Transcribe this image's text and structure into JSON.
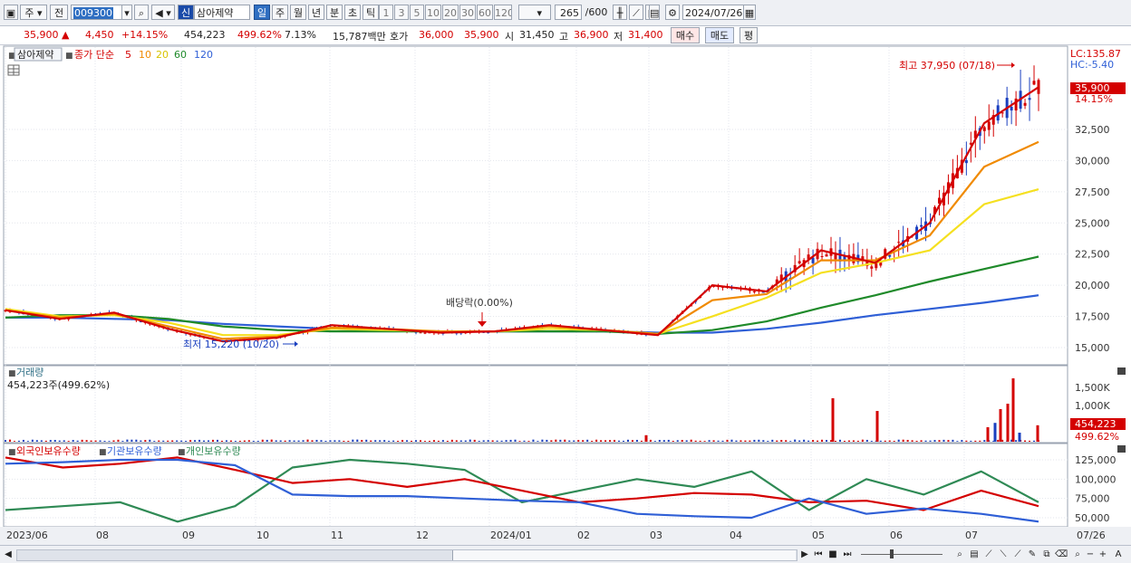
{
  "toolbar": {
    "stock_code": "009300",
    "mode_label": "주",
    "prev_label": "전",
    "sin_label": "신",
    "stock_name": "삼아제약",
    "periods": [
      "일",
      "주",
      "월",
      "년",
      "분",
      "초",
      "틱"
    ],
    "intervals": [
      "1",
      "3",
      "5",
      "10",
      "20",
      "30",
      "60",
      "120"
    ],
    "count": "265",
    "count_total": "/600",
    "date": "2024/07/26"
  },
  "quote": {
    "price": "35,900",
    "change": "4,450",
    "change_pct": "+14.15%",
    "volume": "454,223",
    "vol_ratio": "499.62%",
    "turnover": "7.13%",
    "amount": "15,787백만",
    "hoga_label": "호가",
    "ask": "36,000",
    "bid": "35,900",
    "open_label": "시",
    "open": "31,450",
    "high_label": "고",
    "high": "36,900",
    "low_label": "저",
    "low": "31,400",
    "buy_label": "매수",
    "sell_label": "매도",
    "eval_label": "평"
  },
  "colors": {
    "up": "#d40000",
    "down": "#1a3fbf",
    "ma5": "#d40000",
    "ma10": "#f08a00",
    "ma20": "#f5e020",
    "ma60": "#1f8a2a",
    "ma120": "#2f5fd6",
    "foreign": "#d40000",
    "institution": "#2f5fd6",
    "individual": "#2f8a55"
  },
  "price_panel": {
    "stock_name": "삼아제약",
    "legend_prefix": "종가 단순",
    "ma_periods": [
      "5",
      "10",
      "20",
      "60",
      "120"
    ],
    "lc": "LC:135.87",
    "hc": "HC:-5.40",
    "current_price": "35,900",
    "current_pct": "14.15%",
    "high_annotation": "최고 37,950 (07/18)",
    "low_annotation": "최저 15,220 (10/20)",
    "dividend_annotation": "배당락(0.00%)",
    "y_ticks": [
      "32,500",
      "30,000",
      "27,500",
      "25,000",
      "22,500",
      "20,000",
      "17,500",
      "15,000"
    ]
  },
  "volume_panel": {
    "title": "거래량",
    "summary": "454,223주(499.62%)",
    "y_ticks": [
      "1,500K",
      "1,000K"
    ],
    "current": "454,223",
    "current_pct": "499.62%"
  },
  "holding_panel": {
    "legend": [
      "외국인보유수량",
      "기관보유수량",
      "개인보유수량"
    ],
    "y_ticks": [
      "125,000",
      "100,000",
      "75,000",
      "50,000"
    ]
  },
  "x_axis": {
    "labels": [
      "2023/06",
      "08",
      "09",
      "10",
      "11",
      "12",
      "2024/01",
      "02",
      "03",
      "04",
      "05",
      "06",
      "07"
    ],
    "end_label": "07/26"
  },
  "chart_data": [
    {
      "type": "line",
      "title": "삼아제약",
      "x_range": [
        "2023/06",
        "2024/07/26"
      ],
      "ylim": [
        14000,
        37950
      ],
      "series": [
        {
          "name": "종가 단순 5",
          "approx_values": [
            18000,
            17300,
            17800,
            16500,
            15500,
            15800,
            16800,
            16500,
            16200,
            16300,
            16800,
            16400,
            16000,
            20000,
            19500,
            22800,
            21800,
            25000,
            33000,
            35900
          ]
        },
        {
          "name": "10",
          "approx_values": [
            18000,
            17400,
            17700,
            16700,
            15700,
            15900,
            16600,
            16500,
            16300,
            16300,
            16700,
            16400,
            16100,
            18800,
            19300,
            22000,
            22000,
            24000,
            29500,
            31500
          ]
        },
        {
          "name": "20",
          "approx_values": [
            18100,
            17500,
            17600,
            17000,
            16000,
            16000,
            16500,
            16400,
            16300,
            16300,
            16500,
            16400,
            16100,
            17500,
            19000,
            21000,
            21800,
            22800,
            26500,
            27700
          ]
        },
        {
          "name": "60",
          "approx_values": [
            17400,
            17600,
            17600,
            17300,
            16700,
            16400,
            16300,
            16300,
            16300,
            16300,
            16300,
            16300,
            16100,
            16400,
            17100,
            18200,
            19200,
            20300,
            21300,
            22300
          ]
        },
        {
          "name": "120",
          "approx_values": [
            17400,
            17400,
            17300,
            17200,
            16900,
            16700,
            16500,
            16400,
            16300,
            16300,
            16300,
            16300,
            16200,
            16200,
            16500,
            17000,
            17600,
            18100,
            18600,
            19200
          ]
        }
      ],
      "annotations": {
        "high": 37950,
        "high_date": "07/18",
        "low": 15220,
        "low_date": "10/20",
        "last": 35900
      }
    },
    {
      "type": "bar",
      "title": "거래량",
      "note": "volume spikes near 05, 06 and late 07",
      "spikes": [
        {
          "date": "05",
          "value": 1200000
        },
        {
          "date": "06",
          "value": 850000
        },
        {
          "date": "07 late",
          "value": 1750000
        },
        {
          "date": "07/26",
          "value": 454223
        }
      ]
    },
    {
      "type": "line",
      "title": "보유수량",
      "ylim": [
        40000,
        135000
      ],
      "series": [
        {
          "name": "외국인보유수량",
          "approx_values": [
            128000,
            115000,
            120000,
            128000,
            112000,
            95000,
            100000,
            90000,
            100000,
            85000,
            70000,
            75000,
            82000,
            80000,
            70000,
            72000,
            60000,
            85000,
            65000
          ]
        },
        {
          "name": "기관보유수량",
          "approx_values": [
            120000,
            122000,
            125000,
            125000,
            118000,
            80000,
            78000,
            78000,
            75000,
            72000,
            70000,
            55000,
            52000,
            50000,
            75000,
            55000,
            62000,
            55000,
            45000
          ]
        },
        {
          "name": "개인보유수량",
          "approx_values": [
            60000,
            65000,
            70000,
            45000,
            65000,
            115000,
            125000,
            120000,
            112000,
            70000,
            85000,
            100000,
            90000,
            110000,
            60000,
            100000,
            80000,
            110000,
            70000
          ]
        }
      ]
    }
  ]
}
